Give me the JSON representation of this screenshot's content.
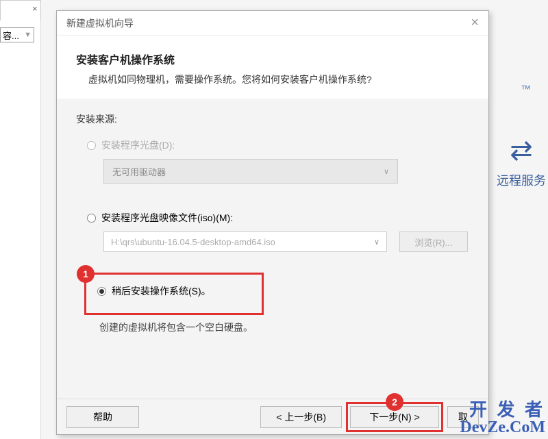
{
  "bg": {
    "dropdown_text": "容...",
    "tm": "™",
    "remote": "远程服务"
  },
  "dialog": {
    "title": "新建虚拟机向导",
    "header_title": "安装客户机操作系统",
    "header_subtitle": "虚拟机如同物理机，需要操作系统。您将如何安装客户机操作系统?",
    "source_label": "安装来源:",
    "opt_disc": "安装程序光盘(D):",
    "disc_dropdown": "无可用驱动器",
    "opt_iso": "安装程序光盘映像文件(iso)(M):",
    "iso_path": "H:\\qrs\\ubuntu-16.04.5-desktop-amd64.iso",
    "browse": "浏览(R)...",
    "opt_later": "稍后安装操作系统(S)。",
    "later_desc": "创建的虚拟机将包含一个空白硬盘。",
    "buttons": {
      "help": "帮助",
      "back": "< 上一步(B)",
      "next": "下一步(N) >",
      "cancel": "取"
    }
  },
  "annotations": {
    "one": "1",
    "two": "2"
  },
  "watermark": {
    "line1": "开 发 者",
    "line2": "DevZe.CoM"
  }
}
